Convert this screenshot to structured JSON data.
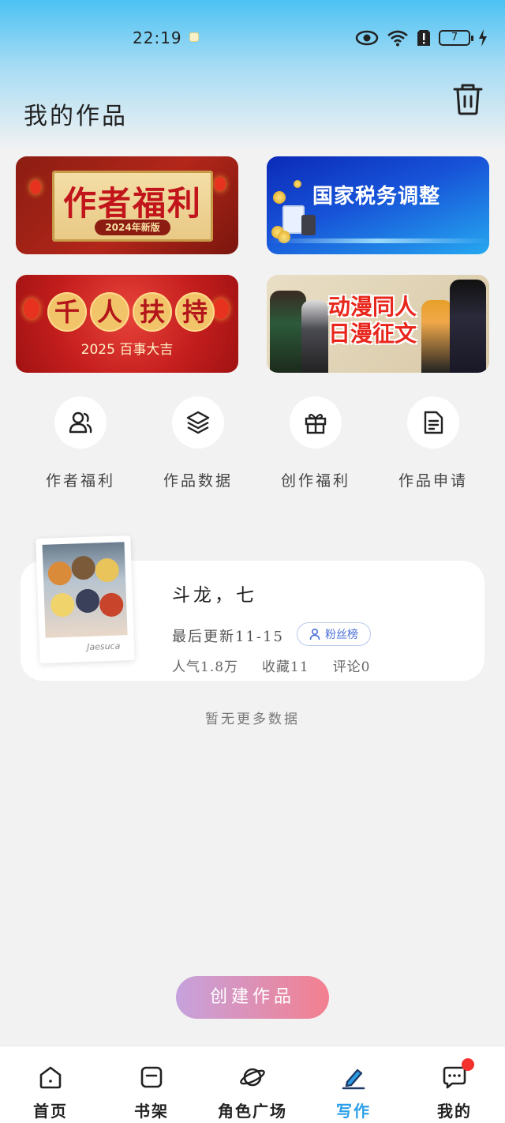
{
  "status_bar": {
    "time": "22:19",
    "battery": "7"
  },
  "header": {
    "title": "我的作品"
  },
  "banners": [
    {
      "title": "作者福利",
      "subtitle": "2024年新版"
    },
    {
      "title": "国家税务调整"
    },
    {
      "title": "千人扶持",
      "title_chars": [
        "千",
        "人",
        "扶",
        "持"
      ],
      "subtitle": "2025 百事大吉"
    },
    {
      "title_line1": "动漫同人",
      "title_line2": "日漫征文"
    }
  ],
  "quick_actions": [
    {
      "label": "作者福利",
      "icon": "users-icon"
    },
    {
      "label": "作品数据",
      "icon": "layers-icon"
    },
    {
      "label": "创作福利",
      "icon": "gift-icon"
    },
    {
      "label": "作品申请",
      "icon": "document-icon"
    }
  ],
  "work": {
    "title": "斗龙，七",
    "last_update": "最后更新11-15",
    "fans_badge": "粉丝榜",
    "popularity": "人气1.8万",
    "favorites": "收藏11",
    "comments": "评论0",
    "cover_sign": "Jaesuca"
  },
  "empty_hint": "暂无更多数据",
  "create_button": "创建作品",
  "bottom_nav": [
    {
      "label": "首页",
      "icon": "home-icon",
      "active": false
    },
    {
      "label": "书架",
      "icon": "bookshelf-icon",
      "active": false
    },
    {
      "label": "角色广场",
      "icon": "planet-icon",
      "active": false
    },
    {
      "label": "写作",
      "icon": "pen-icon",
      "active": true
    },
    {
      "label": "我的",
      "icon": "message-icon",
      "active": false,
      "has_badge": true
    }
  ],
  "colors": {
    "accent_blue": "#2a9ee8",
    "badge_red": "#f5312d",
    "button_gradient_start": "#c6a2dd",
    "button_gradient_end": "#f37f8f"
  }
}
